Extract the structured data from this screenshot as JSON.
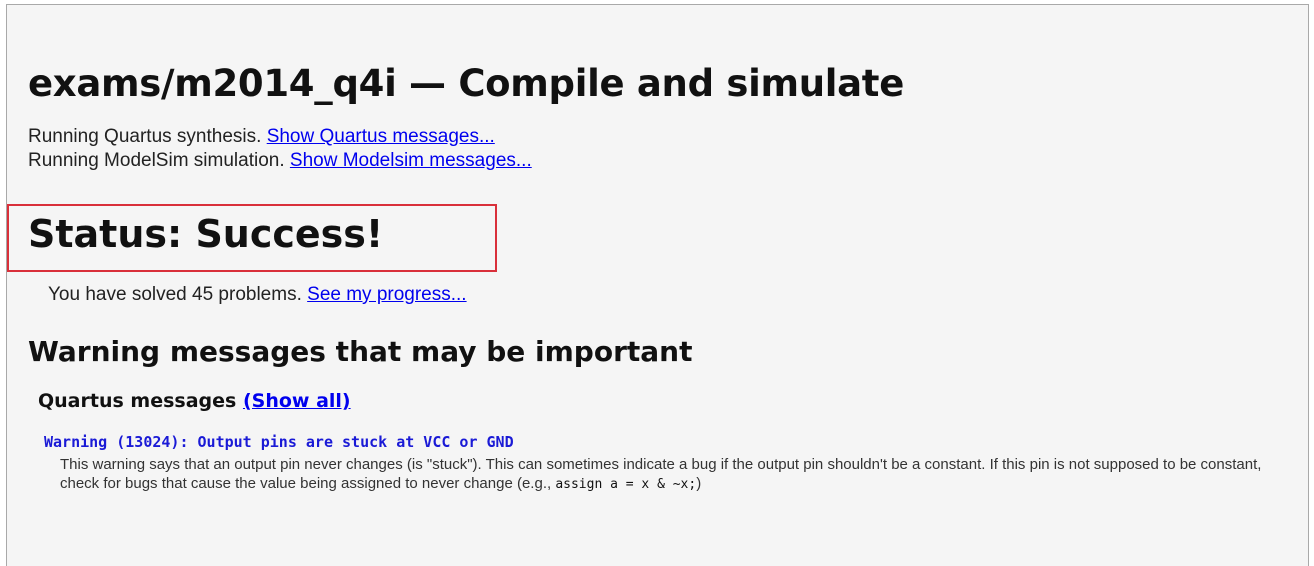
{
  "page": {
    "title": "exams/m2014_q4i — Compile and simulate"
  },
  "compile": {
    "quartus_text": "Running Quartus synthesis.",
    "quartus_link": "Show Quartus messages...",
    "modelsim_text": "Running ModelSim simulation.",
    "modelsim_link": "Show Modelsim messages..."
  },
  "status": {
    "title": "Status: Success!",
    "solved_text": "You have solved 45 problems.",
    "progress_link": "See my progress...",
    "highlight_color": "#d9303a"
  },
  "warnings": {
    "title": "Warning messages that may be important",
    "quartus_header": "Quartus messages",
    "show_all_link": "(Show all)",
    "items": [
      {
        "code": "Warning (13024): Output pins are stuck at VCC or GND",
        "description_prefix": "This warning says that an output pin never changes (is \"stuck\"). This can sometimes indicate a bug if the output pin shouldn't be a constant. If this pin is not supposed to be constant, check for bugs that cause the value being assigned to never change (e.g.,",
        "example_code": "assign a = x & ~x;",
        "description_suffix": ")"
      }
    ]
  },
  "colors": {
    "link": "#0000ee",
    "warning_code": "#1a1ad6",
    "background": "#f5f5f5"
  }
}
